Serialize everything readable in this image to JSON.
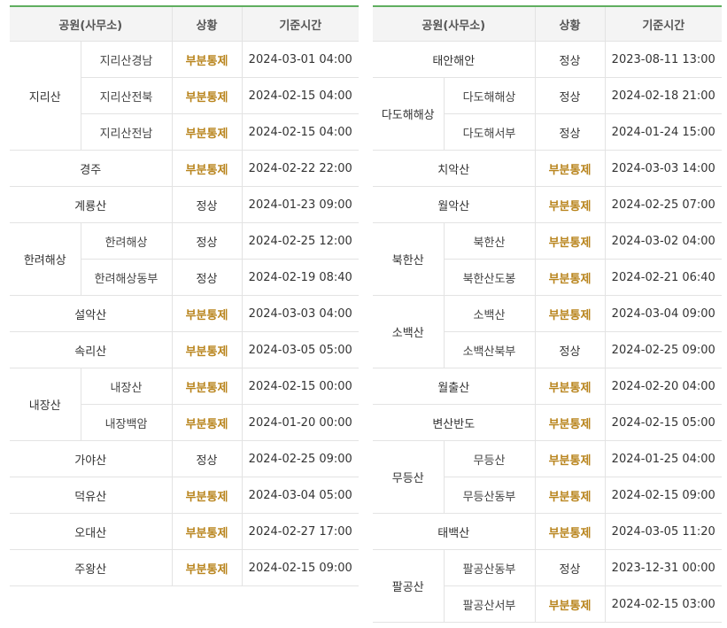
{
  "accent_color": "#5fae5f",
  "partial_color": "#b9851e",
  "headers": {
    "park": "공원(사무소)",
    "status": "상황",
    "time": "기준시간"
  },
  "tables": [
    {
      "rows": [
        {
          "group": "지리산",
          "office": "지리산경남",
          "status": "부분통제",
          "time": "2024-03-01 04:00"
        },
        {
          "group": "지리산",
          "office": "지리산전북",
          "status": "부분통제",
          "time": "2024-02-15 04:00"
        },
        {
          "group": "지리산",
          "office": "지리산전남",
          "status": "부분통제",
          "time": "2024-02-15 04:00"
        },
        {
          "group": "경주",
          "status": "부분통제",
          "time": "2024-02-22 22:00"
        },
        {
          "group": "계룡산",
          "status": "정상",
          "time": "2024-01-23 09:00"
        },
        {
          "group": "한려해상",
          "office": "한려해상",
          "status": "정상",
          "time": "2024-02-25 12:00"
        },
        {
          "group": "한려해상",
          "office": "한려해상동부",
          "status": "정상",
          "time": "2024-02-19 08:40"
        },
        {
          "group": "설악산",
          "status": "부분통제",
          "time": "2024-03-03 04:00"
        },
        {
          "group": "속리산",
          "status": "부분통제",
          "time": "2024-03-05 05:00"
        },
        {
          "group": "내장산",
          "office": "내장산",
          "status": "부분통제",
          "time": "2024-02-15 00:00"
        },
        {
          "group": "내장산",
          "office": "내장백암",
          "status": "부분통제",
          "time": "2024-01-20 00:00"
        },
        {
          "group": "가야산",
          "status": "정상",
          "time": "2024-02-25 09:00"
        },
        {
          "group": "덕유산",
          "status": "부분통제",
          "time": "2024-03-04 05:00"
        },
        {
          "group": "오대산",
          "status": "부분통제",
          "time": "2024-02-27 17:00"
        },
        {
          "group": "주왕산",
          "status": "부분통제",
          "time": "2024-02-15 09:00"
        }
      ]
    },
    {
      "rows": [
        {
          "group": "태안해안",
          "status": "정상",
          "time": "2023-08-11 13:00"
        },
        {
          "group": "다도해해상",
          "office": "다도해해상",
          "status": "정상",
          "time": "2024-02-18 21:00"
        },
        {
          "group": "다도해해상",
          "office": "다도해서부",
          "status": "정상",
          "time": "2024-01-24 15:00"
        },
        {
          "group": "치악산",
          "status": "부분통제",
          "time": "2024-03-03 14:00"
        },
        {
          "group": "월악산",
          "status": "부분통제",
          "time": "2024-02-25 07:00"
        },
        {
          "group": "북한산",
          "office": "북한산",
          "status": "부분통제",
          "time": "2024-03-02 04:00"
        },
        {
          "group": "북한산",
          "office": "북한산도봉",
          "status": "부분통제",
          "time": "2024-02-21 06:40"
        },
        {
          "group": "소백산",
          "office": "소백산",
          "status": "부분통제",
          "time": "2024-03-04 09:00"
        },
        {
          "group": "소백산",
          "office": "소백산북부",
          "status": "정상",
          "time": "2024-02-25 09:00"
        },
        {
          "group": "월출산",
          "status": "부분통제",
          "time": "2024-02-20 04:00"
        },
        {
          "group": "변산반도",
          "status": "부분통제",
          "time": "2024-02-15 05:00"
        },
        {
          "group": "무등산",
          "office": "무등산",
          "status": "부분통제",
          "time": "2024-01-25 04:00"
        },
        {
          "group": "무등산",
          "office": "무등산동부",
          "status": "부분통제",
          "time": "2024-02-15 09:00"
        },
        {
          "group": "태백산",
          "status": "부분통제",
          "time": "2024-03-05 11:20"
        },
        {
          "group": "팔공산",
          "office": "팔공산동부",
          "status": "정상",
          "time": "2023-12-31 00:00"
        },
        {
          "group": "팔공산",
          "office": "팔공산서부",
          "status": "부분통제",
          "time": "2024-02-15 03:00"
        }
      ]
    }
  ]
}
